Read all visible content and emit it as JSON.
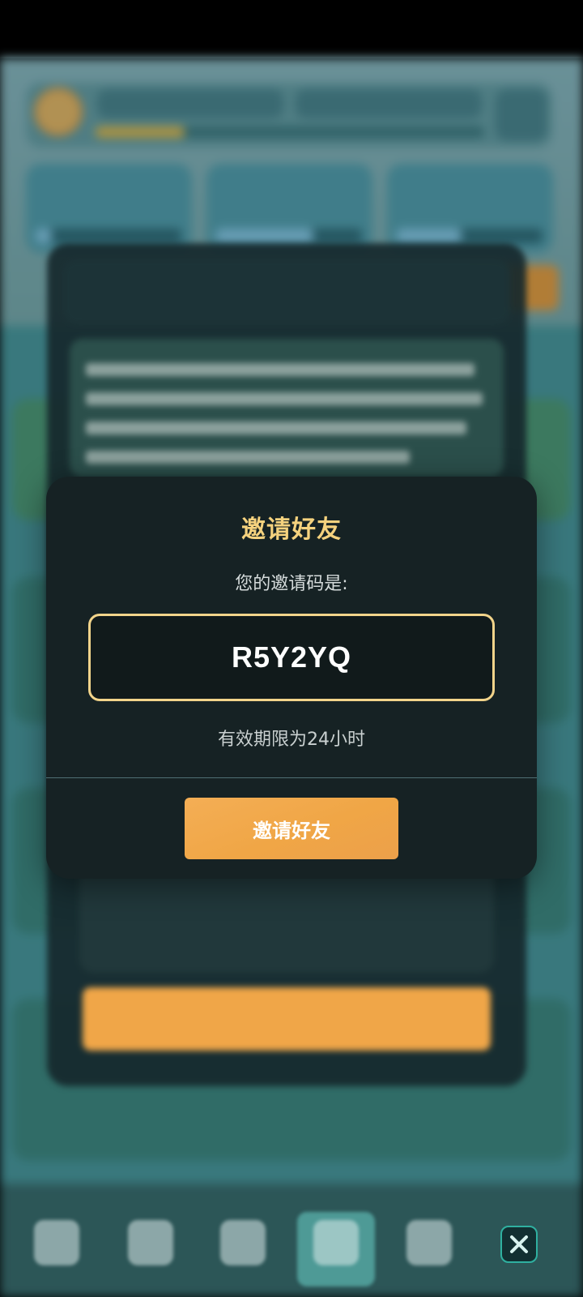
{
  "modal": {
    "title": "邀请好友",
    "code_label": "您的邀请码是:",
    "invite_code": "R5Y2YQ",
    "validity": "有效期限为24小时",
    "invite_button": "邀请好友"
  },
  "colors": {
    "accent_gold": "#f5d27e",
    "button_orange": "#f0a646",
    "modal_bg": "#162224"
  },
  "icons": {
    "close": "close-icon",
    "nav": [
      "home-icon",
      "cards-icon",
      "compass-icon",
      "diamond-icon",
      "heart-icon"
    ]
  }
}
